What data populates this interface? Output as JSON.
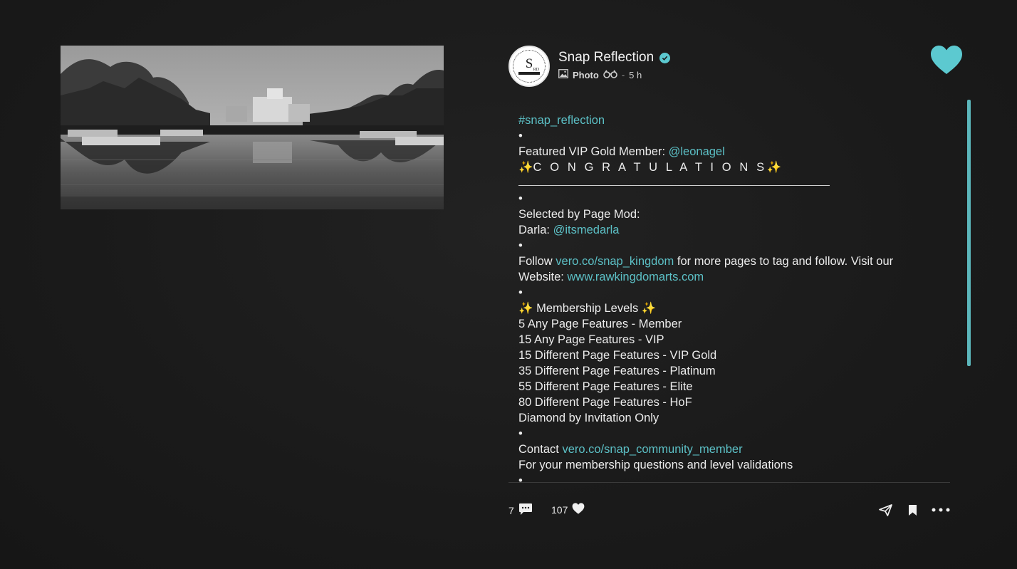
{
  "post": {
    "username": "Snap Reflection",
    "post_type": "Photo",
    "time_separator": "-",
    "time_ago": "5 h",
    "avatar_text": "S"
  },
  "caption": {
    "hashtag": "#snap_reflection",
    "bullet": "•",
    "featured_prefix": "Featured VIP Gold Member: ",
    "featured_handle": "@leonagel",
    "congrats_spark_left": "✨",
    "congrats": "C O N G R A T U L A T I O N S",
    "congrats_spark_right": "✨",
    "selected_by": "Selected by Page Mod:",
    "mod_prefix": "Darla: ",
    "mod_handle": "@itsmedarla",
    "follow_prefix": "Follow ",
    "follow_link": "vero.co/snap_kingdom",
    "follow_suffix": " for more pages to tag and follow. Visit our Website: ",
    "website_link": "www.rawkingdomarts.com",
    "membership_heading": "✨ Membership Levels ✨",
    "levels": [
      "5 Any Page Features - Member",
      "15 Any Page Features - VIP",
      "15 Different Page Features - VIP Gold",
      "35 Different Page Features - Platinum",
      "55 Different Page Features - Elite",
      "80 Different Page Features - HoF",
      "Diamond by Invitation Only"
    ],
    "contact_prefix": "Contact ",
    "contact_link": "vero.co/snap_community_member",
    "contact_note": "For your membership questions and level validations"
  },
  "actions": {
    "comments_count": "7",
    "likes_count": "107"
  },
  "colors": {
    "accent": "#5cc0c6",
    "background": "#1b1b1b",
    "text": "#ececec"
  },
  "icons": {
    "verified": "verified-check-icon",
    "post_type": "photo-icon",
    "audience": "binoculars-icon",
    "like_big": "heart-icon",
    "comments": "comment-bubble-icon",
    "likes": "heart-icon",
    "share": "paper-plane-icon",
    "save": "bookmark-icon",
    "more": "more-dots-icon"
  }
}
